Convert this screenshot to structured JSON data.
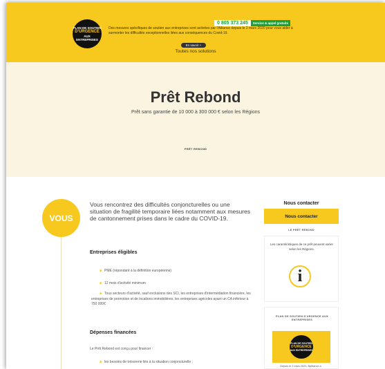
{
  "banner": {
    "logo_lines": [
      "PLAN DE SOUTIEN",
      "D'URGENCE",
      "AUX ENTREPRISES"
    ],
    "text": "Des mesures spécifiques de soutien aux entreprises sont activées par l'Alliance depuis le 2 mars 2020 pour vous aider à surmonter les difficultés exceptionnelles liées aux conséquences du Covid-19.",
    "phone": "0 805 373 245",
    "phone_tag": "Service & appel gratuits",
    "more_button": "En savoir +",
    "solutions_link": "Toutes nos solutions"
  },
  "hero": {
    "title": "Prêt Rebond",
    "subtitle": "Prêt sans garantie de 10 000 à 300 000 € selon les Régions",
    "breadcrumb": "PRÊT REBOND"
  },
  "main": {
    "badge": "VOUS",
    "intro": "Vous rencontrez des difficultés conjoncturelles ou une situation de fragilité temporaire liées notamment aux mesures de cantonnement prises dans le cadre du COVID-19.",
    "eligible_title": "Entreprises éligibles",
    "eligible_items": [
      "PME (répondant à la définition européenne)",
      "12 mois d'activité minimum",
      "Tous secteurs d'activité, sauf exclusions des SCI, les entreprises d'intermédiation financière, les entreprises de promotion et de locations immobilières, les entreprises agricoles ayant un CA inférieur à 750 000€"
    ],
    "expenses_title": "Dépenses financées",
    "expenses_intro": "Le Prêt Rebond est conçu pour financer :",
    "expenses_items": [
      "les besoins de trésorerie liés à la situation conjoncturelle ;"
    ]
  },
  "sidebar": {
    "contact_title": "Nous contacter",
    "contact_button": "Nous contacter",
    "label_pret": "LE PRÊT REBOND",
    "card_text": "Les caractéristiques de ce prêt peuvent varier selon les Régions.",
    "label_plan": "PLAN DE SOUTIEN D'URGENCE AUX ENTREPRISES",
    "caption": "Depuis le 2 mars 2020, Bpifrance a"
  },
  "colors": {
    "brand_yellow": "#f7c81e",
    "hero_bg": "#fbf4e1",
    "phone_green": "#19a337"
  },
  "icons": {
    "info": "info-icon"
  }
}
